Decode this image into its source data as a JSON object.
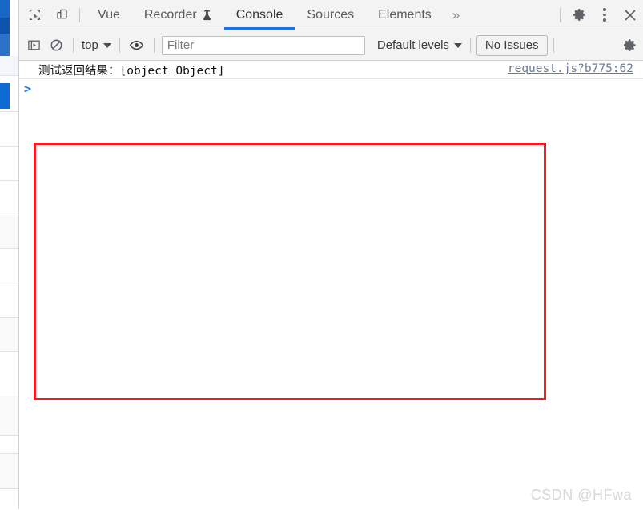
{
  "devtools": {
    "tabbar": {
      "inspect_icon": "inspect-element-icon",
      "device_icon": "device-toolbar-icon",
      "tabs": [
        {
          "label": "Vue",
          "active": false
        },
        {
          "label": "Recorder",
          "active": false,
          "icon": "flask-icon"
        },
        {
          "label": "Console",
          "active": true
        },
        {
          "label": "Sources",
          "active": false
        },
        {
          "label": "Elements",
          "active": false
        }
      ],
      "overflow_label": "»",
      "settings_icon": "gear-icon",
      "more_icon": "more-vertical-icon",
      "close_icon": "close-icon"
    },
    "toolbar": {
      "sidebar_icon": "console-sidebar-icon",
      "clear_icon": "clear-console-icon",
      "context_label": "top",
      "eye_icon": "live-expression-icon",
      "filter_placeholder": "Filter",
      "filter_value": "",
      "levels_label": "Default levels",
      "issues_label": "No Issues",
      "settings_icon": "gear-icon"
    },
    "console": {
      "messages": [
        {
          "text": "测试返回结果：[object Object]",
          "source": "request.js?b775:62"
        }
      ],
      "prompt_chevron": ">",
      "prompt_value": "",
      "prompt_placeholder": ""
    }
  },
  "annotation": {
    "box_color": "#ee1c25"
  },
  "watermark": {
    "text": "CSDN @HFwa"
  },
  "colors": {
    "accent_blue": "#1a73e8",
    "toolbar_bg": "#f3f3f3",
    "page_blue": "#1565c0"
  }
}
